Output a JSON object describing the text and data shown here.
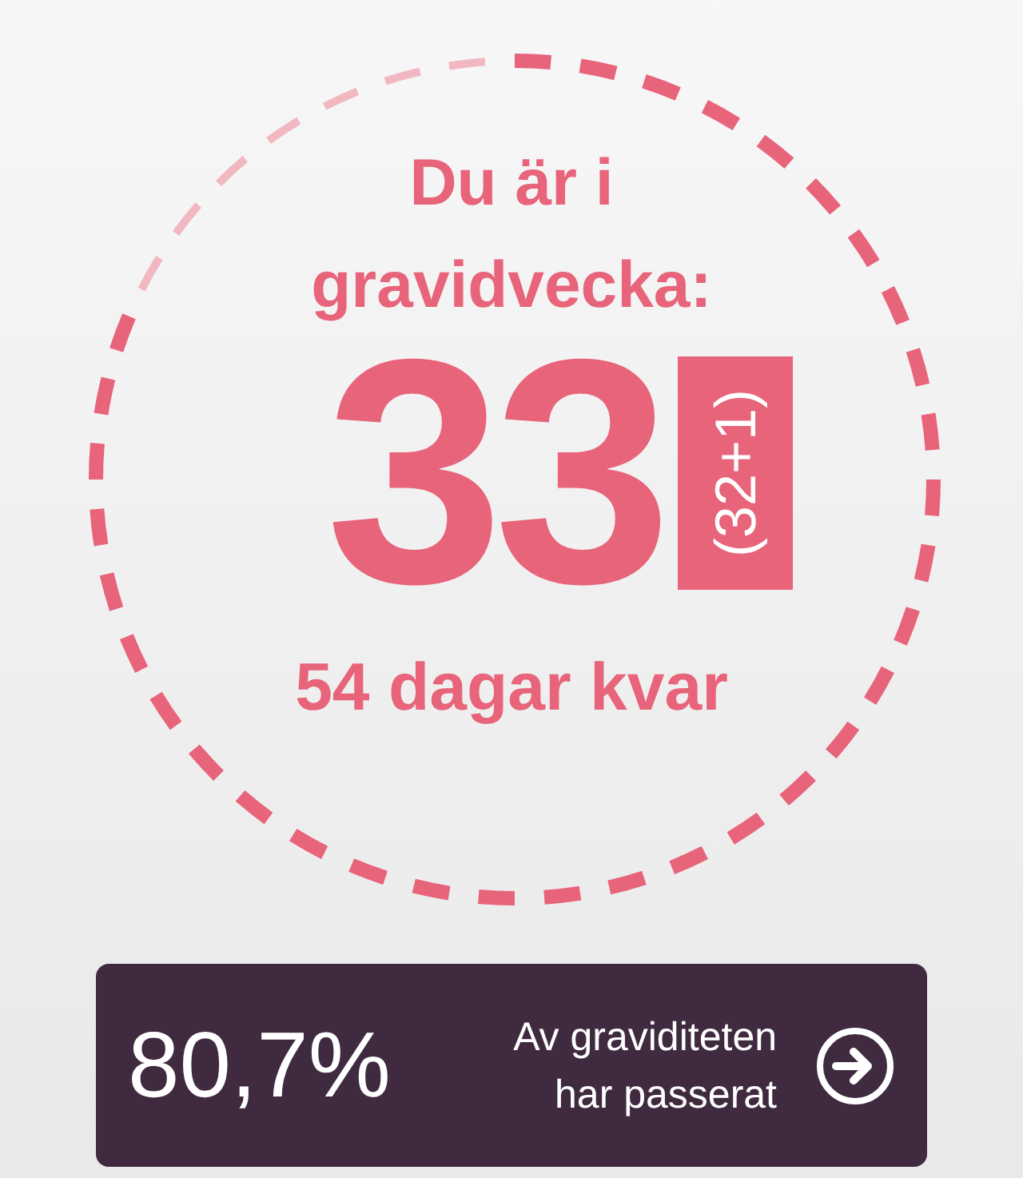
{
  "heading": "Du är i gravidvecka:",
  "week": "33",
  "week_detail": "(32+1)",
  "days_left": "54 dagar kvar",
  "summary": {
    "percent": "80,7%",
    "caption": "Av graviditeten har passerat"
  }
}
